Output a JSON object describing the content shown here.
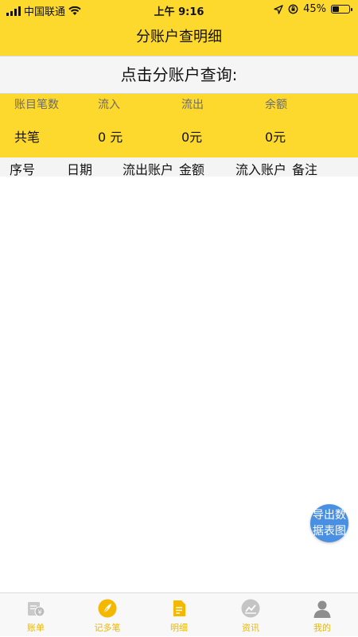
{
  "status_bar": {
    "carrier": "中国联通",
    "time": "上午 9:16",
    "battery_percent": "45%",
    "battery_level": 0.45,
    "icons": [
      "signal-icon",
      "wifi-icon",
      "location-icon",
      "orientation-lock-icon",
      "battery-icon"
    ]
  },
  "nav": {
    "title": "分账户查明细"
  },
  "query": {
    "label": "点击分账户查询:"
  },
  "summary": {
    "headers": [
      "账目笔数",
      "流入",
      "流出",
      "余额"
    ],
    "values": [
      "共笔",
      "0 元",
      "0元",
      "0元"
    ]
  },
  "table": {
    "columns": [
      "序号",
      "日期",
      "流出账户",
      "金额",
      "流入账户",
      "备注"
    ]
  },
  "fab": {
    "line1": "导出数",
    "line2": "据表图"
  },
  "tabs": [
    {
      "label": "账单",
      "icon": "bill-icon"
    },
    {
      "label": "记多笔",
      "icon": "feather-icon"
    },
    {
      "label": "明细",
      "icon": "document-icon"
    },
    {
      "label": "资讯",
      "icon": "chart-icon"
    },
    {
      "label": "我的",
      "icon": "person-icon"
    }
  ],
  "colors": {
    "accent_yellow": "#FDD92E",
    "tab_label": "#E9B800",
    "fab_blue": "#4A90E2"
  }
}
